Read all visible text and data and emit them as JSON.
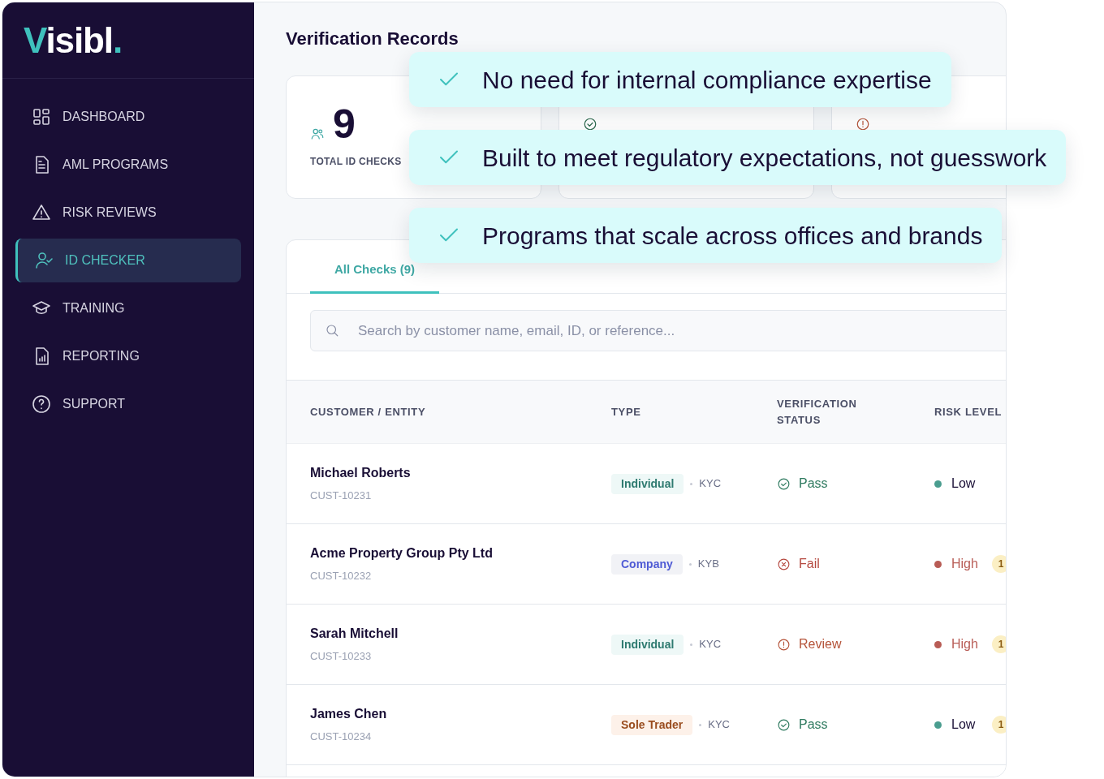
{
  "logo": {
    "parts": [
      "V",
      "isibl",
      "."
    ]
  },
  "sidebar": {
    "items": [
      {
        "label": "DASHBOARD",
        "selected": false
      },
      {
        "label": "AML PROGRAMS",
        "selected": false
      },
      {
        "label": "RISK REVIEWS",
        "selected": false
      },
      {
        "label": "ID CHECKER",
        "selected": true
      },
      {
        "label": "TRAINING",
        "selected": false
      },
      {
        "label": "REPORTING",
        "selected": false
      },
      {
        "label": "SUPPORT",
        "selected": false
      }
    ]
  },
  "page_title": "Verification Records",
  "stats": [
    {
      "kind": "total",
      "value": "9",
      "label": "TOTAL ID CHECKS"
    },
    {
      "kind": "pass"
    },
    {
      "kind": "review"
    }
  ],
  "tabs": [
    {
      "label": "All Checks (9)",
      "selected": true
    }
  ],
  "search": {
    "placeholder": "Search by customer name, email, ID, or reference..."
  },
  "table": {
    "columns": [
      "CUSTOMER / ENTITY",
      "TYPE",
      "VERIFICATION STATUS",
      "RISK LEVEL"
    ],
    "rows": [
      {
        "name": "Michael Roberts",
        "id": "CUST-10231",
        "type": {
          "label": "Individual",
          "kind": "individual"
        },
        "check": "KYC",
        "status": {
          "label": "Pass",
          "kind": "pass"
        },
        "risk": "Low",
        "color": "#4a9d8f"
      },
      {
        "name": "Acme Property Group Pty Ltd",
        "id": "CUST-10232",
        "type": {
          "label": "Company",
          "kind": "company"
        },
        "check": "KYB",
        "status": {
          "label": "Fail",
          "kind": "fail"
        },
        "risk": "High",
        "color": "#b85c55",
        "flag": "1"
      },
      {
        "name": "Sarah Mitchell",
        "id": "CUST-10233",
        "type": {
          "label": "Individual",
          "kind": "individual"
        },
        "check": "KYC",
        "status": {
          "label": "Review",
          "kind": "review"
        },
        "risk": "High",
        "color": "#b85c55",
        "flag": "1"
      },
      {
        "name": "James Chen",
        "id": "CUST-10234",
        "type": {
          "label": "Sole Trader",
          "kind": "sole"
        },
        "check": "KYC",
        "status": {
          "label": "Pass",
          "kind": "pass"
        },
        "risk": "Low",
        "color": "#4a9d8f",
        "flag": "1"
      }
    ]
  },
  "callouts": [
    "No need for internal compliance expertise",
    "Built to meet regulatory expectations, not guesswork",
    "Programs that scale across offices and brands"
  ]
}
